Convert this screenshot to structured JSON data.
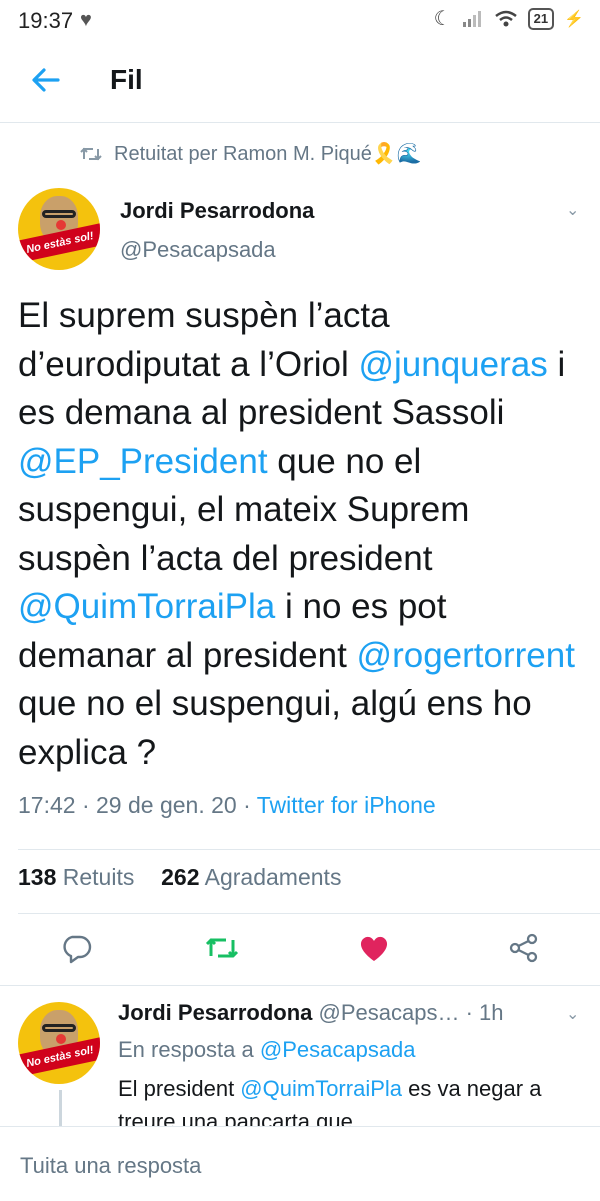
{
  "status_bar": {
    "time": "19:37",
    "battery": "21"
  },
  "header": {
    "title": "Fil"
  },
  "retweet": {
    "label": "Retuitat per Ramon M. Piqué🎗️🌊"
  },
  "tweet": {
    "author_name": "Jordi Pesarrodona",
    "author_handle": "@Pesacapsada",
    "avatar_text": "No estàs sol!",
    "segments": {
      "t1": "El suprem suspèn l’acta d’eurodiputat a l’Oriol ",
      "m1": "@junqueras",
      "t2": " i es demana al president Sassoli  ",
      "m2": "@EP_President",
      "t3": " que no el suspengui, el mateix Suprem suspèn l’acta del president ",
      "m3": "@QuimTorraiPla",
      "t4": " i no es pot demanar al president ",
      "m4": "@rogertorrent",
      "t5": " que no el suspengui, algú ens ho explica ?"
    },
    "time": "17:42",
    "date": "29 de gen. 20",
    "source": "Twitter for iPhone",
    "retweets_count": "138",
    "retweets_label": "Retuits",
    "likes_count": "262",
    "likes_label": "Agradaments"
  },
  "reply": {
    "author_name": "Jordi Pesarrodona",
    "author_handle": "@Pesacaps…",
    "age": "1h",
    "reply_prefix": "En resposta a",
    "reply_to": "@Pesacapsada",
    "body_t1": "El president ",
    "body_m1": "@QuimTorraiPla",
    "body_t2": " es va negar a treure una pancarta que"
  },
  "composer": {
    "placeholder": "Tuita una resposta"
  },
  "colors": {
    "accent": "#1da1f2",
    "retweet_green": "#17bf63",
    "like_red": "#e0245e",
    "muted": "#657786"
  }
}
